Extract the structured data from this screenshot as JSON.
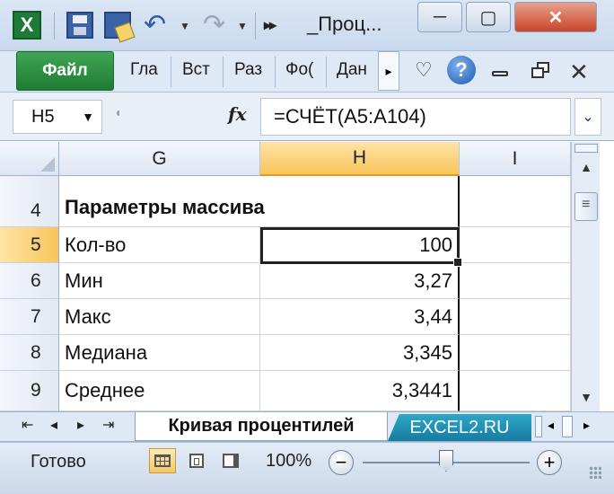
{
  "titlebar": {
    "app_icon": "excel-icon",
    "app_icon_letter": "X",
    "title": "_Проц...",
    "quick_access": [
      "save-icon",
      "save-as-icon",
      "undo-icon",
      "redo-icon"
    ],
    "more_glyph": "▸▸",
    "window_buttons": {
      "minimize": "─",
      "restore": "▢",
      "close": "✕"
    }
  },
  "ribbon": {
    "file_tab": "Файл",
    "tabs": [
      "Гла",
      "Вст",
      "Раз",
      "Фо(",
      "Дан"
    ],
    "scroll_glyph": "▸",
    "help_glyph": "?"
  },
  "formula_bar": {
    "name_box": "H5",
    "fx_label": "fx",
    "formula": "=СЧЁТ(A5:A104)"
  },
  "grid": {
    "columns": [
      "G",
      "H",
      "I"
    ],
    "active_column": "H",
    "rows": [
      {
        "num": "4",
        "g": "Параметры массива",
        "h": ""
      },
      {
        "num": "5",
        "g": "Кол-во",
        "h": "100"
      },
      {
        "num": "6",
        "g": "Мин",
        "h": "3,27"
      },
      {
        "num": "7",
        "g": "Макс",
        "h": "3,44"
      },
      {
        "num": "8",
        "g": "Медиана",
        "h": "3,345"
      },
      {
        "num": "9",
        "g": "Среднее",
        "h": "3,3441"
      }
    ],
    "active_row": "5"
  },
  "sheets": {
    "active": "Кривая процентилей",
    "other": "EXCEL2.RU"
  },
  "statusbar": {
    "status": "Готово",
    "zoom": "100%",
    "zoom_fraction": 0.5
  },
  "colors": {
    "file_tab": "#2a8f3f",
    "active_header": "#f8c55c",
    "sheet_tab2": "#1f8fb5"
  }
}
